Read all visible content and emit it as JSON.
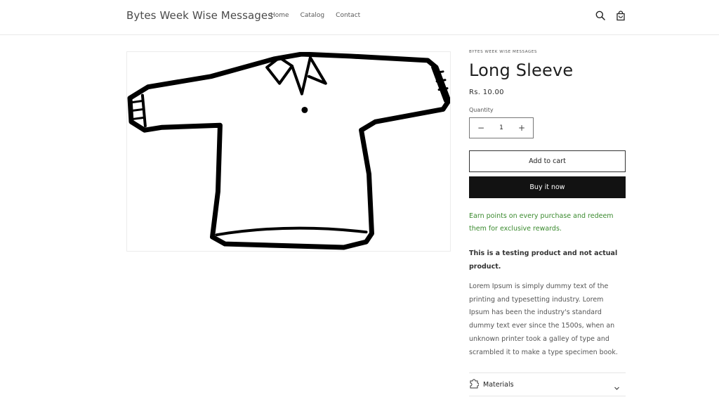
{
  "header": {
    "brand": "Bytes Week Wise Messages",
    "nav": [
      {
        "label": "Home"
      },
      {
        "label": "Catalog"
      },
      {
        "label": "Contact"
      }
    ],
    "icons": [
      "search-icon",
      "cart-icon"
    ]
  },
  "product": {
    "vendor": "BYTES WEEK WISE MESSAGES",
    "title": "Long Sleeve",
    "price": "Rs. 10.00",
    "quantity_label": "Quantity",
    "quantity": "1",
    "add_to_cart": "Add to cart",
    "buy_now": "Buy it now",
    "points_text": "Earn points on every purchase and redeem them for exclusive rewards.",
    "bold_note": "This is a testing product and not actual product.",
    "description": "Lorem Ipsum is simply dummy text of the printing and typesetting industry. Lorem Ipsum has been the industry's standard dummy text ever since the 1500s, when an unknown printer took a galley of type and scrambled it to make a type specimen book.",
    "accordion": {
      "label": "Materials",
      "icon": "materials-icon"
    }
  },
  "colors": {
    "accent_green": "#3a8a2e",
    "button_dark": "#121212"
  }
}
